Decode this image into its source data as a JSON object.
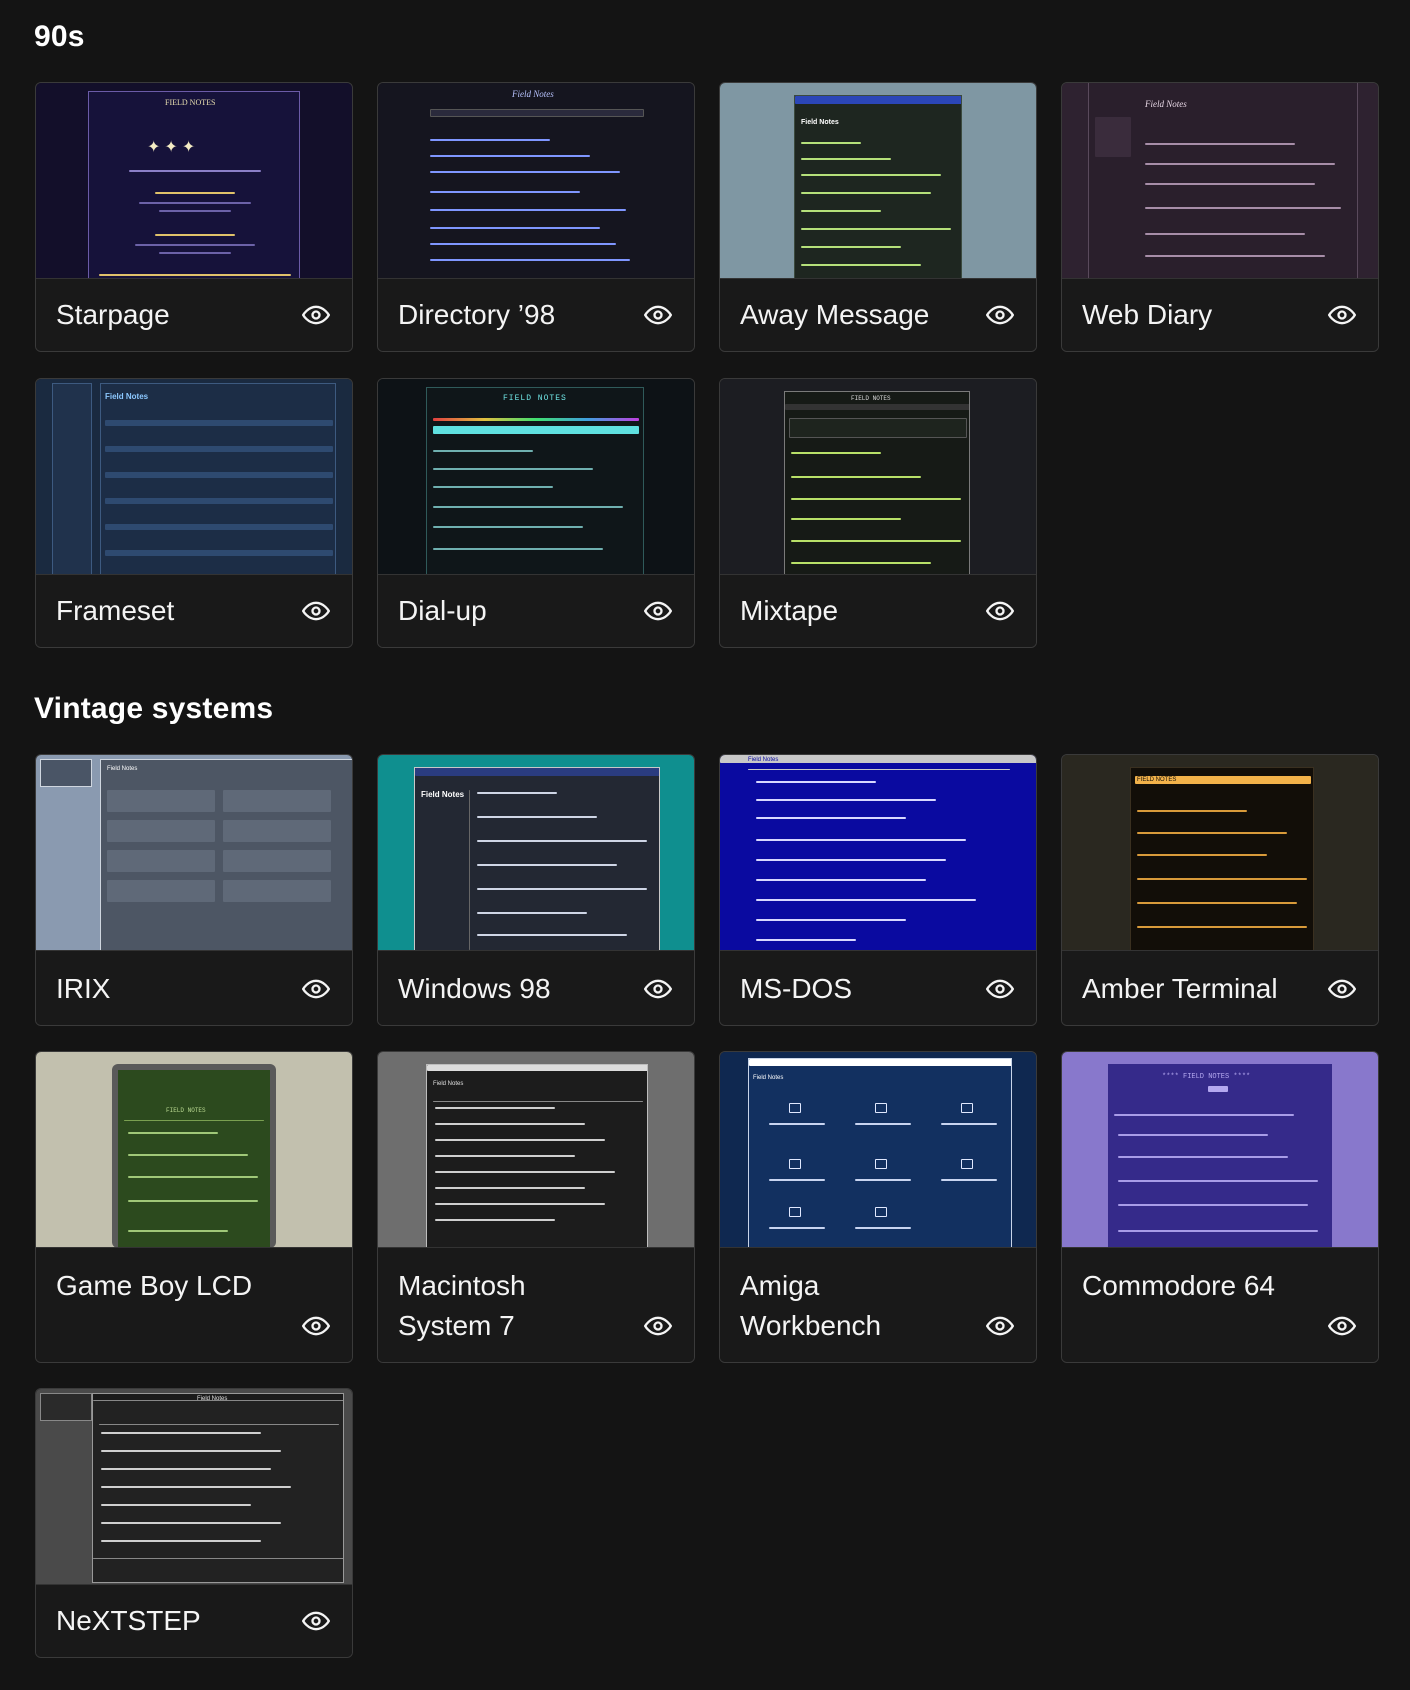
{
  "sections": [
    {
      "title": "90s",
      "items": [
        {
          "label": "Starpage",
          "icon": "eye-icon",
          "thumb_title": "FIELD NOTES"
        },
        {
          "label": "Directory ’98",
          "icon": "eye-icon",
          "thumb_title": "Field Notes"
        },
        {
          "label": "Away Message",
          "icon": "eye-icon",
          "thumb_title": "Field Notes"
        },
        {
          "label": "Web Diary",
          "icon": "eye-icon",
          "thumb_title": "Field Notes"
        },
        {
          "label": "Frameset",
          "icon": "eye-icon",
          "thumb_title": "Field Notes"
        },
        {
          "label": "Dial-up",
          "icon": "eye-icon",
          "thumb_title": "FIELD NOTES"
        },
        {
          "label": "Mixtape",
          "icon": "eye-icon",
          "thumb_title": "FIELD NOTES"
        }
      ]
    },
    {
      "title": "Vintage systems",
      "items": [
        {
          "label": "IRIX",
          "icon": "eye-icon",
          "thumb_title": "Field Notes"
        },
        {
          "label": "Windows 98",
          "icon": "eye-icon",
          "thumb_title": "Field Notes"
        },
        {
          "label": "MS-DOS",
          "icon": "eye-icon",
          "thumb_title": "Field Notes"
        },
        {
          "label": "Amber Terminal",
          "icon": "eye-icon",
          "thumb_title": "FIELD NOTES"
        },
        {
          "label": "Game Boy LCD",
          "icon": "eye-icon",
          "thumb_title": "FIELD NOTES"
        },
        {
          "label": "Macintosh\nSystem 7",
          "icon": "eye-icon",
          "thumb_title": "Field Notes"
        },
        {
          "label": "Amiga\nWorkbench",
          "icon": "eye-icon",
          "thumb_title": "Field Notes"
        },
        {
          "label": "Commodore 64",
          "icon": "eye-icon",
          "thumb_title": "**** FIELD NOTES ****"
        },
        {
          "label": "NeXTSTEP",
          "icon": "eye-icon",
          "thumb_title": "Field Notes"
        }
      ]
    }
  ],
  "colors": {
    "page_bg": "#141414",
    "card_border": "#3a3a3a",
    "text": "#f4f4f4"
  }
}
